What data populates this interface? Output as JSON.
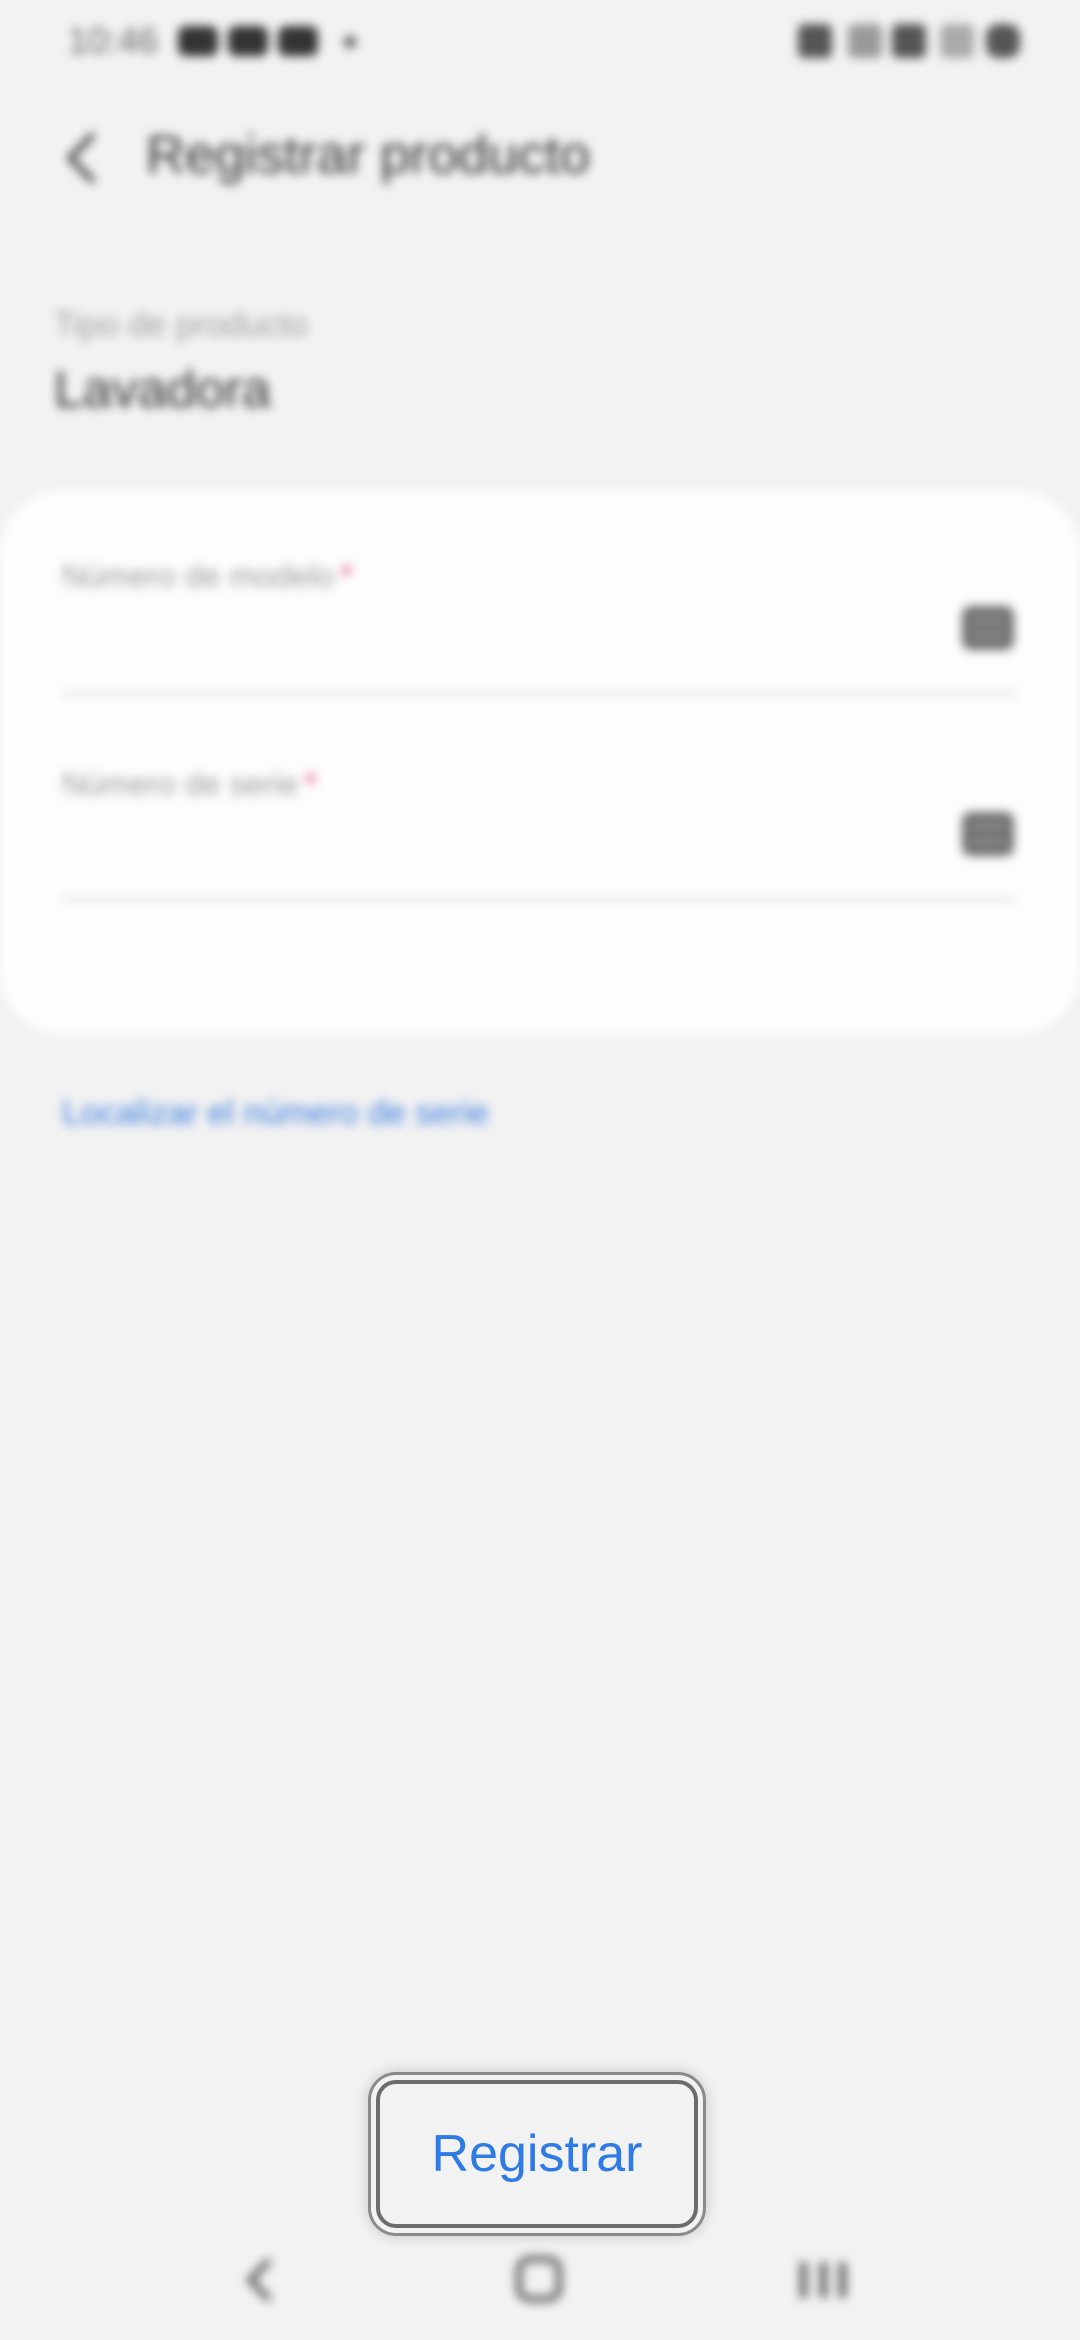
{
  "status_bar": {
    "time": "10:46"
  },
  "header": {
    "title": "Registrar producto",
    "back_icon": "chevron-left-icon"
  },
  "product_type": {
    "label": "Tipo de producto",
    "value": "Lavadora"
  },
  "form": {
    "model_number": {
      "label": "Número de modelo",
      "required_mark": "*",
      "value": "",
      "icon": "keyboard-icon"
    },
    "serial_number": {
      "label": "Número de serie",
      "required_mark": "*",
      "value": "",
      "icon": "keyboard-icon"
    }
  },
  "locate_link": "Localizar el número de serie",
  "register_button": "Registrar",
  "nav_bar": {
    "icons": [
      "nav-back-icon",
      "nav-home-icon",
      "nav-recents-icon"
    ]
  },
  "colors": {
    "background": "#f2f2f2",
    "card": "#fdfdfd",
    "accent": "#2f7be6",
    "required": "#e0416b"
  }
}
